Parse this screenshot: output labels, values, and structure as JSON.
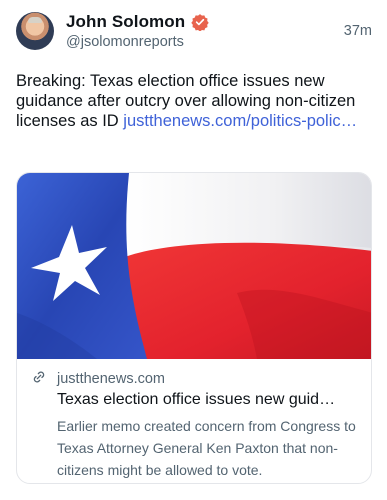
{
  "author": {
    "display_name": "John Solomon",
    "handle": "@jsolomonreports",
    "verified_icon": "verified-badge-icon",
    "badge_color": "#e8634d"
  },
  "post": {
    "time": "37m",
    "text": "Breaking: Texas election office issues new guidance after outcry over allowing non-citizen licenses as ID ",
    "link_text": "justthenews.com/politics-polic…",
    "link_color": "#3f62d8"
  },
  "card": {
    "image_icon": "texas-flag-image",
    "link_icon": "link-icon",
    "domain": "justthenews.com",
    "title": "Texas election office issues new guid…",
    "description": "Earlier memo created concern from Congress to Texas Attorney General Ken Paxton that non-citizens might be allowed to vote."
  },
  "colors": {
    "text_primary": "#0f1419",
    "text_secondary": "#536471",
    "flag_blue": "#2a4fbf",
    "flag_red": "#e8252f"
  }
}
